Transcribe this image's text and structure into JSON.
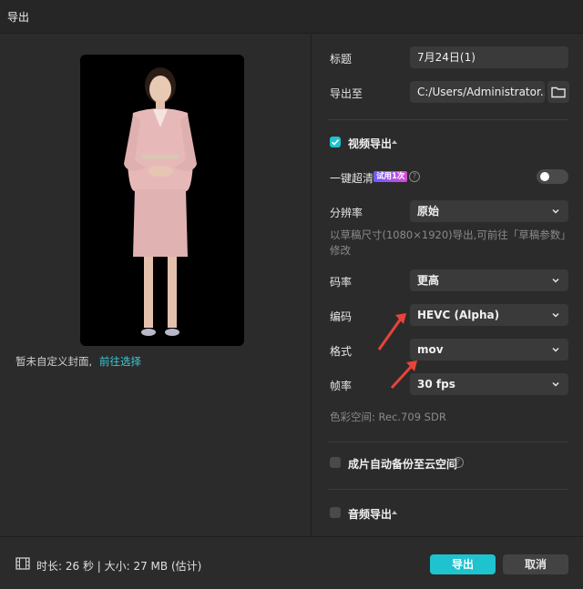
{
  "window": {
    "title": "导出"
  },
  "preview": {
    "cover_note": "暂未自定义封面,",
    "cover_link": "前往选择"
  },
  "form": {
    "title_label": "标题",
    "title_value": "7月24日(1)",
    "export_to_label": "导出至",
    "export_path": "C:/Users/Administrator...",
    "video_export": {
      "label": "视频导出",
      "checked": true
    },
    "one_click_hd": {
      "label": "一键超清",
      "badge": "试用1次",
      "help": "?",
      "enabled": false
    },
    "resolution": {
      "label": "分辨率",
      "value": "原始"
    },
    "hint": "以草稿尺寸(1080×1920)导出,可前往「草稿参数」修改",
    "bitrate": {
      "label": "码率",
      "value": "更高"
    },
    "codec": {
      "label": "编码",
      "value": "HEVC (Alpha)"
    },
    "format": {
      "label": "格式",
      "value": "mov"
    },
    "framerate": {
      "label": "帧率",
      "value": "30 fps"
    },
    "color_space": "色彩空间: Rec.709 SDR",
    "cloud_backup": {
      "label": "成片自动备份至云空间",
      "help": "?",
      "checked": false
    },
    "audio_export": {
      "label": "音频导出",
      "checked": false
    }
  },
  "footer": {
    "info": "时长: 26 秒 | 大小: 27 MB (估计)",
    "export_button": "导出",
    "cancel_button": "取消"
  },
  "colors": {
    "accent": "#1fc2cf",
    "annotation_arrow": "#e8443a",
    "background": "#2b2b2b"
  },
  "icons": [
    "folder-icon",
    "checkmark-icon",
    "chevron-down-icon",
    "caret-up-icon",
    "help-icon",
    "film-icon"
  ]
}
